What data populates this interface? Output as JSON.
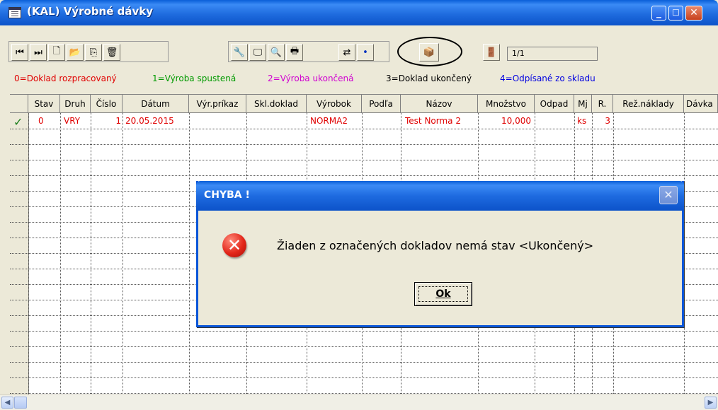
{
  "window": {
    "title": "(KAL) Výrobné dávky",
    "minimize": "_",
    "maximize": "☐",
    "close": "✕"
  },
  "toolbar": {
    "record_counter": "1/1"
  },
  "legend": {
    "items": [
      {
        "label": "0=Doklad rozpracovaný",
        "color": "#e00000"
      },
      {
        "label": "1=Výroba spustená",
        "color": "#009a00"
      },
      {
        "label": "2=Výroba ukončená",
        "color": "#d000d0"
      },
      {
        "label": "3=Doklad ukončený",
        "color": "#000000"
      },
      {
        "label": "4=Odpísané zo skladu",
        "color": "#0000e0"
      }
    ]
  },
  "grid": {
    "columns": [
      "Stav",
      "Druh",
      "Číslo",
      "Dátum",
      "Výr.príkaz",
      "Skl.doklad",
      "Výrobok",
      "Podľa",
      "Názov",
      "Množstvo",
      "Odpad",
      "Mj",
      "R.",
      "Rež.náklady",
      "Dávka"
    ],
    "rows": [
      {
        "stav": "0",
        "druh": "VRY",
        "cislo": "1",
        "datum": "20.05.2015",
        "vyr_prikaz": "",
        "skl_doklad": "",
        "vyrobok": "NORMA2",
        "podla": "",
        "nazov": "Test Norma 2",
        "mnozstvo": "10,000",
        "odpad": "",
        "mj": "ks",
        "r": "3",
        "rez_naklady": "",
        "davka": ""
      }
    ]
  },
  "dialog": {
    "title": "CHYBA !",
    "message": "Žiaden z označených dokladov nemá stav <Ukončený>",
    "ok_label": "Ok"
  }
}
